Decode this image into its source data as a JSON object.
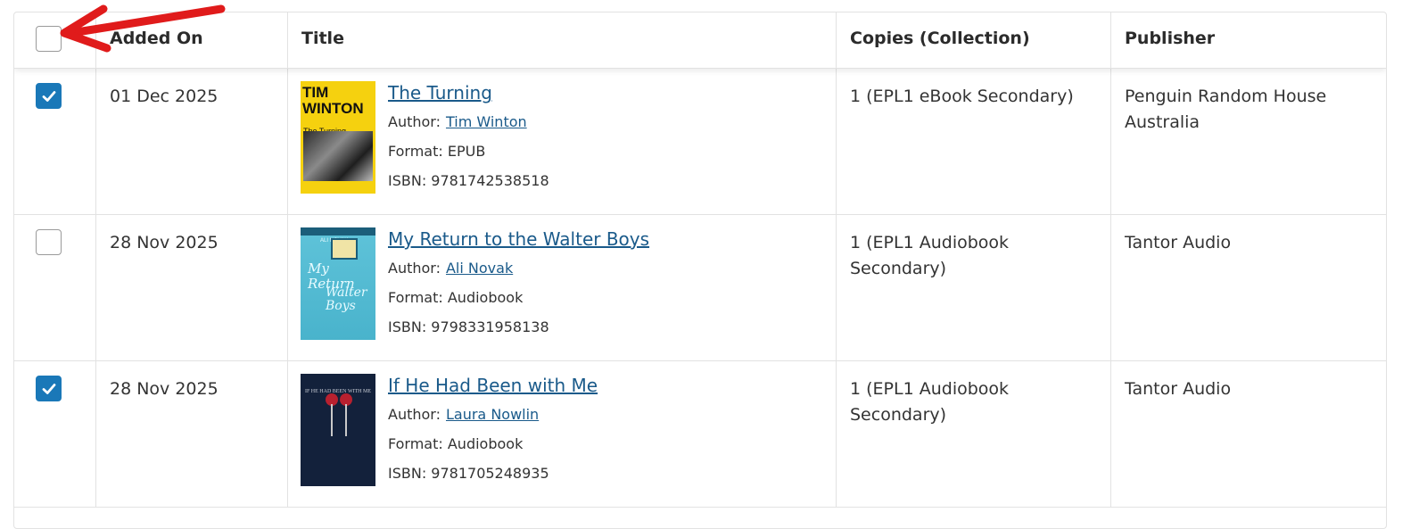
{
  "header": {
    "added_on": "Added On",
    "title": "Title",
    "copies": "Copies (Collection)",
    "publisher": "Publisher",
    "select_all_checked": false
  },
  "rows": [
    {
      "checked": true,
      "added_on": "01 Dec 2025",
      "title": "The Turning",
      "author_label": "Author:",
      "author": "Tim Winton",
      "format": "Format: EPUB",
      "isbn": "ISBN: 9781742538518",
      "copies": "1 (EPL1 eBook Secondary)",
      "publisher": "Penguin Random House Australia",
      "cover": {
        "line1": "TIM",
        "line2": "WINTON",
        "sub": "The Turning"
      }
    },
    {
      "checked": false,
      "added_on": "28 Nov 2025",
      "title": "My Return to the Walter Boys",
      "author_label": "Author:",
      "author": "Ali Novak",
      "format": "Format: Audiobook",
      "isbn": "ISBN: 9798331958138",
      "copies": "1 (EPL1 Audiobook Secondary)",
      "publisher": "Tantor Audio",
      "cover": {
        "top": "ALI NOVAK",
        "script1": "My Return",
        "script2": "Walter Boys"
      }
    },
    {
      "checked": true,
      "added_on": "28 Nov 2025",
      "title": "If He Had Been with Me",
      "author_label": "Author:",
      "author": "Laura Nowlin",
      "format": "Format: Audiobook",
      "isbn": "ISBN: 9781705248935",
      "copies": "1 (EPL1 Audiobook Secondary)",
      "publisher": "Tantor Audio",
      "cover": {
        "top": "IF HE HAD BEEN WITH ME"
      }
    }
  ],
  "colors": {
    "checkbox_checked": "#1a78b8",
    "link": "#1a5a8a",
    "arrow": "#e01b1b",
    "border": "#e2e2e2"
  },
  "icons": [
    "checkmark-icon",
    "red-arrow-annotation"
  ]
}
